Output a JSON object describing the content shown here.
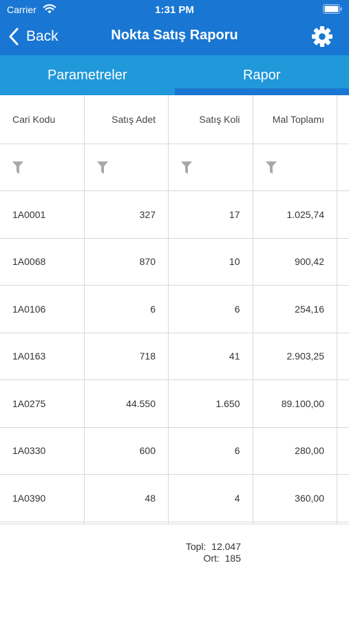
{
  "status_bar": {
    "carrier": "Carrier",
    "time": "1:31 PM"
  },
  "nav": {
    "back_label": "Back",
    "title": "Nokta Satış Raporu",
    "settings_icon": "gear-icon"
  },
  "tabs": [
    {
      "label": "Parametreler",
      "selected": false
    },
    {
      "label": "Rapor",
      "selected": true
    }
  ],
  "table": {
    "columns": [
      "Cari Kodu",
      "Satış Adet",
      "Satış Koli",
      "Mal Toplamı"
    ],
    "rows": [
      [
        "1A0001",
        "327",
        "17",
        "1.025,74"
      ],
      [
        "1A0068",
        "870",
        "10",
        "900,42"
      ],
      [
        "1A0106",
        "6",
        "6",
        "254,16"
      ],
      [
        "1A0163",
        "718",
        "41",
        "2.903,25"
      ],
      [
        "1A0275",
        "44.550",
        "1.650",
        "89.100,00"
      ],
      [
        "1A0330",
        "600",
        "6",
        "280,00"
      ],
      [
        "1A0390",
        "48",
        "4",
        "360,00"
      ]
    ]
  },
  "summary": {
    "total_label": "Topl:",
    "total_value": "12.047",
    "avg_label": "Ort:",
    "avg_value": "185"
  },
  "colors": {
    "header_blue": "#1976d2",
    "tab_blue": "#2098da",
    "grid_line": "#d8d8d8",
    "filter_icon": "#a8a8a8"
  }
}
